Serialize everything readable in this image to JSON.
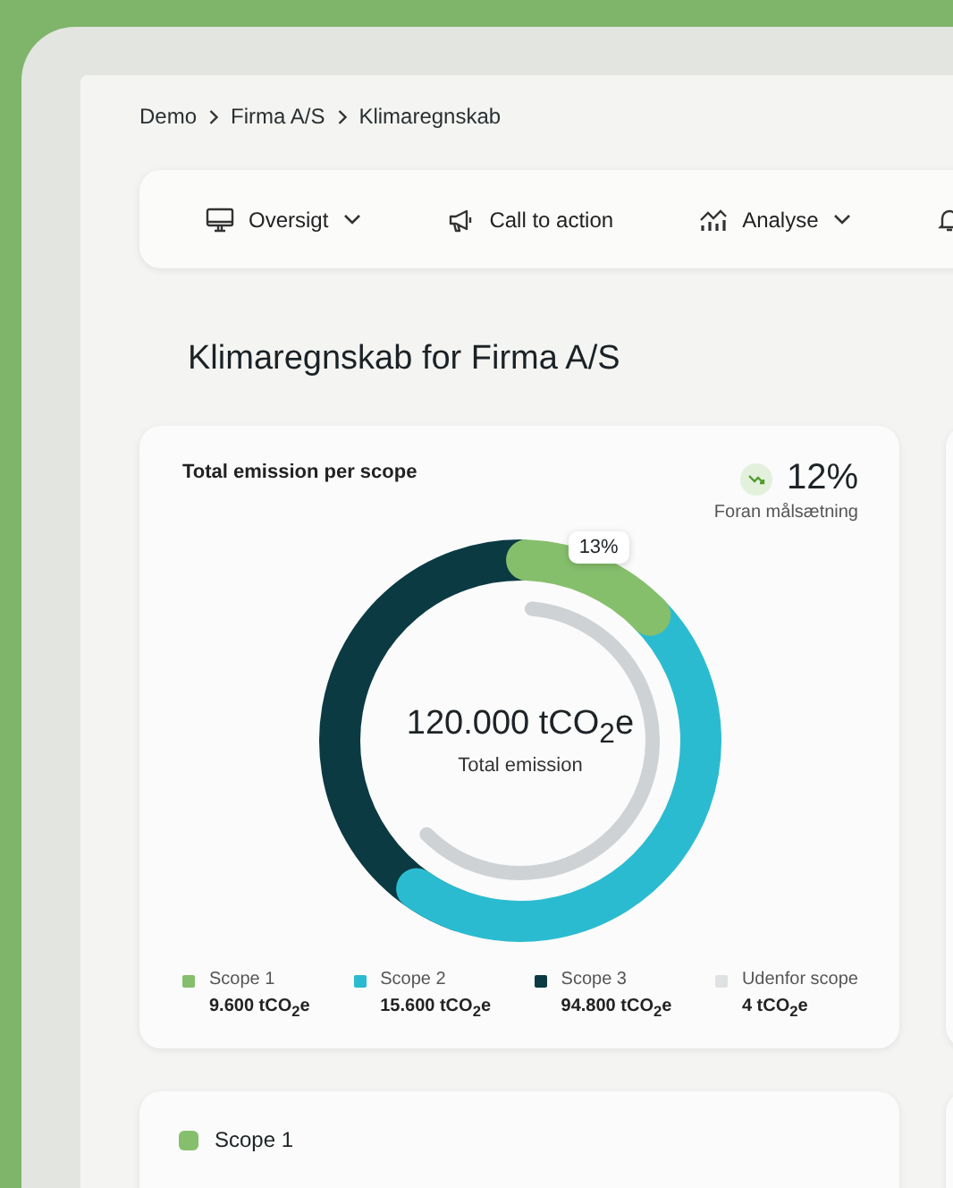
{
  "breadcrumb": [
    "Demo",
    "Firma A/S",
    "Klimaregnskab"
  ],
  "nav": [
    {
      "kind": "monitor",
      "label": "Oversigt",
      "dropdown": true
    },
    {
      "kind": "megaphone",
      "label": "Call to action",
      "dropdown": false
    },
    {
      "kind": "chart",
      "label": "Analyse",
      "dropdown": true
    },
    {
      "kind": "bell"
    }
  ],
  "page_title": "Klimaregnskab for Firma A/S",
  "emission_card": {
    "title": "Total emission per scope",
    "trend": {
      "value": "12%",
      "caption": "Foran målsætning"
    },
    "tooltip": "13%",
    "total": "120.000 tCO$_{2}$e",
    "total_label": "Total emission",
    "legend": [
      {
        "label": "Scope 1",
        "value": "9.600 tCO$_{2}$e",
        "color": "#86bf6c"
      },
      {
        "label": "Scope 2",
        "value": "15.600 tCO$_{2}$e",
        "color": "#2bbbd0"
      },
      {
        "label": "Scope 3",
        "value": "94.800 tCO$_{2}$e",
        "color": "#0b3a43"
      },
      {
        "label": "Udenfor scope",
        "value": "4 tCO$_{2}$e",
        "color": "#dfe1e3"
      }
    ]
  },
  "scope_card": {
    "title": "Scope 1",
    "color": "#86bf6c"
  }
}
